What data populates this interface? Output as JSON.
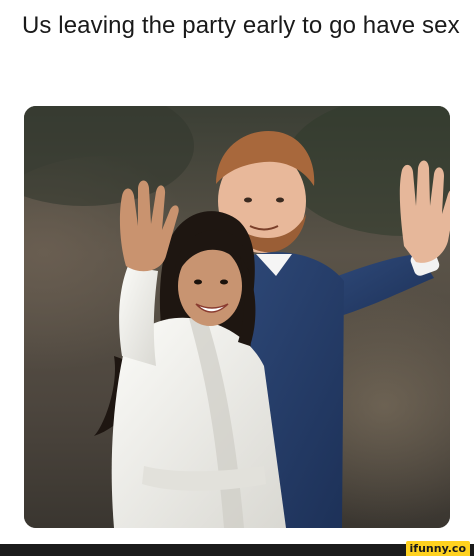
{
  "meme": {
    "caption": "Us leaving the party early to go have sex",
    "photo_icon": "couple-waving-photo"
  },
  "watermark": {
    "text": "ifunny.co",
    "bg_color": "#ffd21f"
  },
  "colors": {
    "background": "#ffffff",
    "footer_bar": "#1b1b1b",
    "caption_text": "#1a1a1a"
  }
}
